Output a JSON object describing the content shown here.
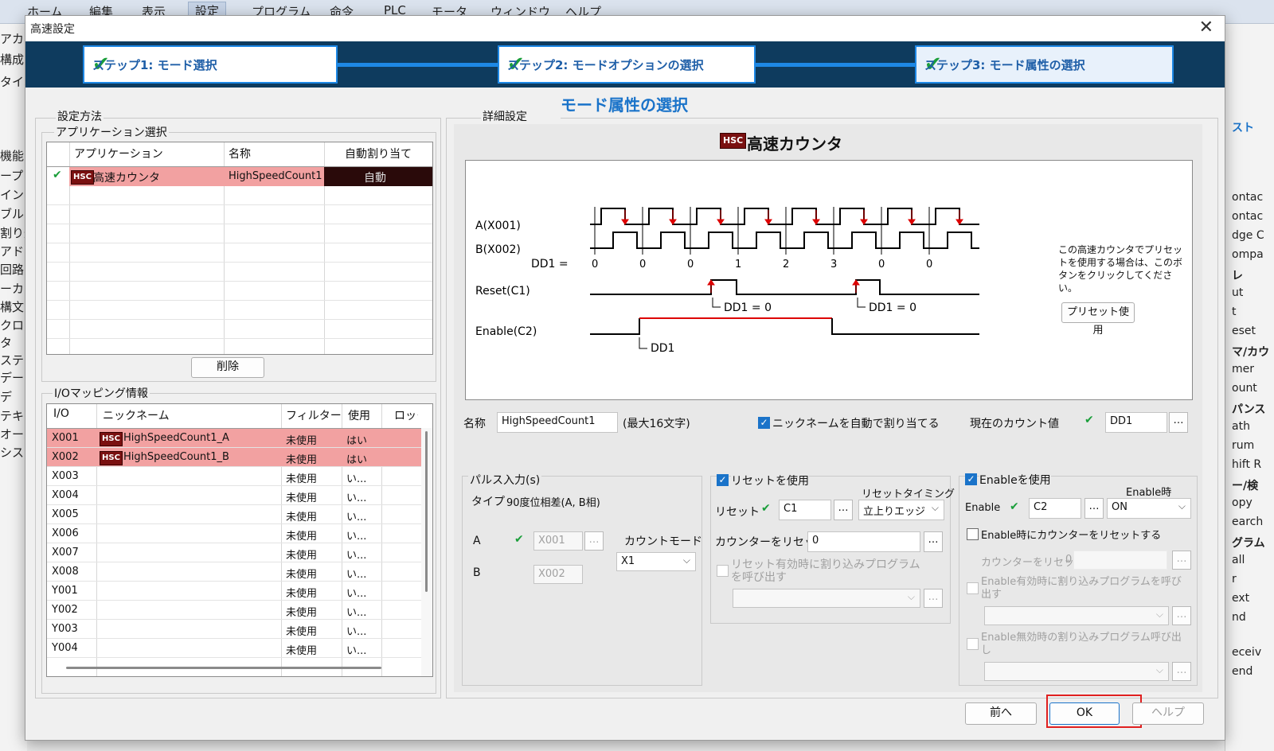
{
  "menubar": [
    "ホーム",
    "編集",
    "表示",
    "設定",
    "プログラム",
    "命令",
    "PLC",
    "モータ",
    "ウィンドウ",
    "ヘルプ"
  ],
  "left_strip": [
    "アカ",
    "構成",
    "タイム",
    "機能",
    "ープロ",
    "イン",
    "ブル",
    "割り込",
    "アドレ",
    "回路",
    "ーカ",
    "構文",
    "クロス",
    "タ",
    "ステー",
    "データ",
    "デ",
    "テキス",
    "オーバ",
    "システ"
  ],
  "right_strip": [
    "スト",
    "ontac",
    "ontac",
    "dge C",
    "ompa",
    "レ",
    "ut",
    "t",
    "eset",
    "マ/カウ",
    "mer",
    "ount",
    "パンス",
    "ath",
    "rum",
    "hift R",
    "ー/検",
    "opy",
    "earch",
    "グラム",
    "all",
    "r",
    "ext",
    "nd",
    "eceiv",
    "end"
  ],
  "dialog": {
    "title": "高速設定",
    "close": "✕",
    "steps": [
      "ステップ1: モード選択",
      "ステップ2: モードオプションの選択",
      "ステップ3: モード属性の選択"
    ],
    "heading": "モード属性の選択"
  },
  "left": {
    "group": "設定方法",
    "app_group": "アプリケーション選択",
    "app_table": {
      "headers": [
        "アプリケーション",
        "名称",
        "自動割り当て"
      ],
      "row": {
        "app": "高速カウンタ",
        "name": "HighSpeedCount1",
        "auto": "自動"
      }
    },
    "delete_button": "削除",
    "io_group": "I/Oマッピング情報",
    "io_table": {
      "headers": [
        "I/O",
        "ニックネーム",
        "フィルター",
        "使用",
        "ロック"
      ],
      "rows": [
        {
          "io": "X001",
          "nick": "HighSpeedCount1_A",
          "filter": "未使用",
          "use": "はい",
          "hsc": true
        },
        {
          "io": "X002",
          "nick": "HighSpeedCount1_B",
          "filter": "未使用",
          "use": "はい",
          "hsc": true
        },
        {
          "io": "X003",
          "nick": "",
          "filter": "未使用",
          "use": "い...",
          "hsc": false
        },
        {
          "io": "X004",
          "nick": "",
          "filter": "未使用",
          "use": "い...",
          "hsc": false
        },
        {
          "io": "X005",
          "nick": "",
          "filter": "未使用",
          "use": "い...",
          "hsc": false
        },
        {
          "io": "X006",
          "nick": "",
          "filter": "未使用",
          "use": "い...",
          "hsc": false
        },
        {
          "io": "X007",
          "nick": "",
          "filter": "未使用",
          "use": "い...",
          "hsc": false
        },
        {
          "io": "X008",
          "nick": "",
          "filter": "未使用",
          "use": "い...",
          "hsc": false
        },
        {
          "io": "Y001",
          "nick": "",
          "filter": "未使用",
          "use": "い...",
          "hsc": false
        },
        {
          "io": "Y002",
          "nick": "",
          "filter": "未使用",
          "use": "い...",
          "hsc": false
        },
        {
          "io": "Y003",
          "nick": "",
          "filter": "未使用",
          "use": "い...",
          "hsc": false
        },
        {
          "io": "Y004",
          "nick": "",
          "filter": "未使用",
          "use": "い...",
          "hsc": false
        }
      ]
    }
  },
  "right": {
    "group": "詳細設定",
    "hsc_badge": "HSC",
    "title": "高速カウンタ",
    "diagram": {
      "a_label": "A(X001)",
      "b_label": "B(X002)",
      "dd1_label": "DD1 =",
      "dd1_values": [
        "0",
        "0",
        "0",
        "1",
        "2",
        "3",
        "0",
        "0"
      ],
      "reset_label": "Reset(C1)",
      "reset_note": "DD1 = 0",
      "enable_label": "Enable(C2)",
      "enable_note": "DD1"
    },
    "preset_text": "この高速カウンタでプリセットを使用する場合は、このボタンをクリックしてください。",
    "preset_button": "プリセット使用",
    "name_label": "名称",
    "name_value": "HighSpeedCount1",
    "name_hint": "(最大16文字)",
    "auto_nick": "ニックネームを自動で割り当てる",
    "current_count_label": "現在のカウント値",
    "current_count_value": "DD1",
    "pulse": {
      "group": "パルス入力(s)",
      "type_label": "タイプ",
      "type_value": "90度位相差(A, B相)",
      "a_label": "A",
      "a_value": "X001",
      "b_label": "B",
      "b_value": "X002",
      "count_mode_label": "カウントモード",
      "count_mode_value": "X1"
    },
    "reset": {
      "use_label": "リセットを使用",
      "timing_label": "リセットタイミング",
      "reset_label": "リセット",
      "reset_value": "C1",
      "timing_value": "立上りエッジ",
      "counter_reset_label": "カウンターをリセット",
      "counter_reset_value": "0",
      "interrupt_label": "リセット有効時に割り込みプログラムを呼び出す"
    },
    "enable": {
      "use_label": "Enableを使用",
      "when_label": "Enable時",
      "enable_label": "Enable",
      "enable_value": "C2",
      "when_value": "ON",
      "reset_on_enable": "Enable時にカウンターをリセットする",
      "counter_reset_label": "カウンターをリセット",
      "counter_reset_value": "0",
      "interrupt_on": "Enable有効時に割り込みプログラムを呼び出す",
      "interrupt_off": "Enable無効時の割り込みプログラム呼び出し"
    }
  },
  "footer": {
    "back": "前へ",
    "ok": "OK",
    "help": "ヘルプ"
  },
  "colors": {
    "band": "#0e3b5e",
    "accent": "#1a73c9",
    "selected_row": "#f2a1a1",
    "check": "#1a9e3a",
    "ok_highlight": "#e02020"
  }
}
